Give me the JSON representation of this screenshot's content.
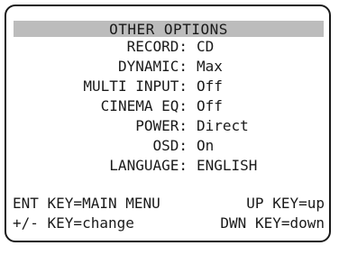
{
  "title": "OTHER OPTIONS",
  "options": [
    {
      "label": "RECORD:",
      "value": "CD"
    },
    {
      "label": "DYNAMIC:",
      "value": "Max"
    },
    {
      "label": "MULTI INPUT:",
      "value": "Off"
    },
    {
      "label": "CINEMA EQ:",
      "value": "Off"
    },
    {
      "label": "POWER:",
      "value": "Direct"
    },
    {
      "label": "OSD:",
      "value": "On"
    },
    {
      "label": "LANGUAGE:",
      "value": "ENGLISH"
    }
  ],
  "footer": {
    "row1_left": "ENT KEY=MAIN MENU",
    "row1_right": "UP KEY=up",
    "row2_left": "+/- KEY=change",
    "row2_right": "DWN KEY=down"
  },
  "colors": {
    "title_bar": "#bcbcbc",
    "text": "#1a1a1a",
    "border": "#1a1a1a"
  }
}
